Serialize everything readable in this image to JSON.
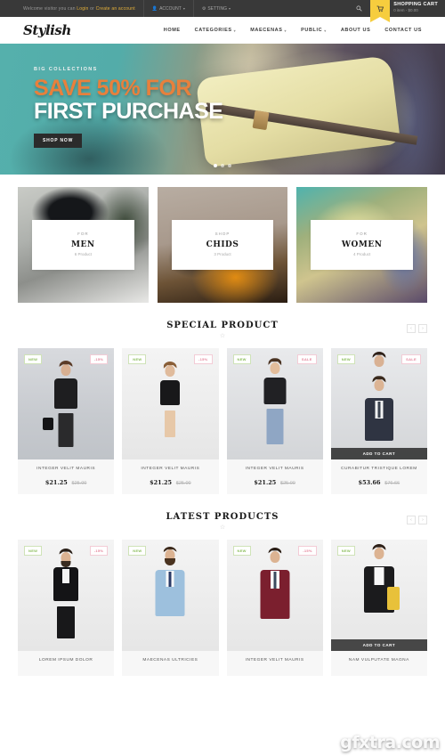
{
  "topbar": {
    "welcome_prefix": "Welcome visitor you can",
    "login_label": "Login",
    "or_label": "or",
    "register_label": "Create an account",
    "account_label": "ACCOUNT",
    "setting_label": "SETTING",
    "search_icon": "search-icon",
    "cart_icon": "cart-icon",
    "cart_title": "SHOPPING CART",
    "cart_sub": "0 item - $0.00"
  },
  "header": {
    "logo": "Stylish",
    "nav": [
      {
        "label": "HOME",
        "has_caret": false
      },
      {
        "label": "CATEGORIES",
        "has_caret": true
      },
      {
        "label": "MAECENAS",
        "has_caret": true
      },
      {
        "label": "PUBLIC",
        "has_caret": true
      },
      {
        "label": "ABOUT US",
        "has_caret": false
      },
      {
        "label": "CONTACT US",
        "has_caret": false
      }
    ]
  },
  "hero": {
    "kicker": "BIG COLLECTIONS",
    "line1": "SAVE 50% FOR",
    "line2": "FIRST PURCHASE",
    "cta": "SHOP NOW",
    "accent_color": "#e8803c"
  },
  "categories": [
    {
      "pre": "FOR",
      "name": "MEN",
      "count": "6 Product"
    },
    {
      "pre": "SHOP",
      "name": "CHIDS",
      "count": "3 Product"
    },
    {
      "pre": "FOR",
      "name": "WOMEN",
      "count": "4 Product"
    }
  ],
  "special": {
    "title": "SPECIAL PRODUCT",
    "divider_icon": "star-icon",
    "prev_icon": "chevron-left-icon",
    "next_icon": "chevron-right-icon",
    "products": [
      {
        "title": "INTEGER VELIT MAURIS",
        "price": "$21.25",
        "old_price": "$25.00",
        "badge_new": "NEW",
        "badge_off": "-15%",
        "add_to_cart": ""
      },
      {
        "title": "INTEGER VELIT MAURIS",
        "price": "$21.25",
        "old_price": "$25.00",
        "badge_new": "NEW",
        "badge_off": "-15%",
        "add_to_cart": ""
      },
      {
        "title": "INTEGER VELIT MAURIS",
        "price": "$21.25",
        "old_price": "$25.00",
        "badge_new": "NEW",
        "badge_off": "SALE",
        "add_to_cart": ""
      },
      {
        "title": "CURABITUR TRISTIQUE LOREM",
        "price": "$53.66",
        "old_price": "$76.66",
        "badge_new": "NEW",
        "badge_off": "SALE",
        "add_to_cart": "ADD TO CART"
      }
    ]
  },
  "latest": {
    "title": "LATEST PRODUCTS",
    "divider_icon": "star-icon",
    "prev_icon": "chevron-left-icon",
    "next_icon": "chevron-right-icon",
    "products": [
      {
        "title": "LOREM IPSUM DOLOR",
        "badge_new": "NEW",
        "badge_off": "-15%",
        "add_to_cart": ""
      },
      {
        "title": "MAECENAS ULTRICIES",
        "badge_new": "NEW",
        "badge_off": "",
        "add_to_cart": ""
      },
      {
        "title": "INTEGER VELIT MAURIS",
        "badge_new": "NEW",
        "badge_off": "-15%",
        "add_to_cart": ""
      },
      {
        "title": "NAM VULPUTATE MAGNA",
        "badge_new": "NEW",
        "badge_off": "",
        "add_to_cart": "ADD TO CART"
      }
    ]
  },
  "watermark": "gfxtra.com"
}
